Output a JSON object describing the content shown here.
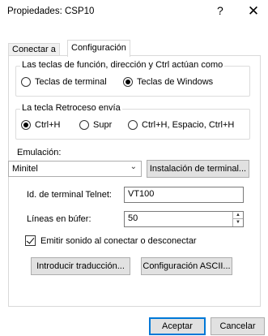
{
  "window": {
    "title": "Propiedades: CSP10",
    "help_label": "?",
    "close_label": "✕"
  },
  "tabs": [
    {
      "label": "Conectar a",
      "active": false
    },
    {
      "label": "Configuración",
      "active": true
    }
  ],
  "function_keys_group": {
    "label": "Las teclas de función, dirección y Ctrl actúan como",
    "options": [
      {
        "label": "Teclas de terminal",
        "selected": false
      },
      {
        "label": "Teclas de Windows",
        "selected": true
      }
    ]
  },
  "backspace_group": {
    "label": "La tecla Retroceso envía",
    "options": [
      {
        "label": "Ctrl+H",
        "selected": true
      },
      {
        "label": "Supr",
        "selected": false
      },
      {
        "label": "Ctrl+H, Espacio, Ctrl+H",
        "selected": false
      }
    ]
  },
  "emulation": {
    "label": "Emulación:",
    "value": "Minitel",
    "setup_button": "Instalación de terminal..."
  },
  "telnet_id": {
    "label": "Id. de terminal Telnet:",
    "value": "VT100"
  },
  "buffer_lines": {
    "label": "Líneas en búfer:",
    "value": "50"
  },
  "beep": {
    "label": "Emitir sonido al conectar o desconectar",
    "checked": true
  },
  "translation_button": "Introducir traducción...",
  "ascii_button": "Configuración ASCII...",
  "footer": {
    "accept": "Aceptar",
    "cancel": "Cancelar"
  }
}
